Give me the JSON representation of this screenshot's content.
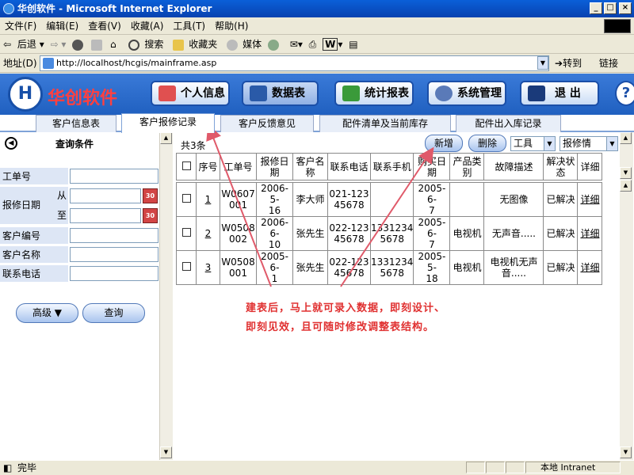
{
  "window": {
    "title": "华创软件 - Microsoft Internet Explorer",
    "controls": [
      "_",
      "□",
      "×"
    ]
  },
  "menu": [
    "文件(F)",
    "编辑(E)",
    "查看(V)",
    "收藏(A)",
    "工具(T)",
    "帮助(H)"
  ],
  "toolbar": {
    "back": "后退",
    "search": "搜索",
    "favorites": "收藏夹",
    "media": "媒体"
  },
  "address": {
    "label": "地址(D)",
    "url": "http://localhost/hcgis/mainframe.asp",
    "go": "转到",
    "links": "链接"
  },
  "app": {
    "logo": "H",
    "brand": "华创软件",
    "nav": [
      "个人信息",
      "数据表",
      "统计报表",
      "系统管理",
      "退  出"
    ],
    "help": "?"
  },
  "tabs": [
    "客户信息表",
    "客户报修记录",
    "客户反馈意见",
    "配件清单及当前库存",
    "配件出入库记录"
  ],
  "query": {
    "title": "查询条件",
    "fields": {
      "ticket": "工单号",
      "date": "报修日期",
      "from": "从",
      "to": "至",
      "cust_no": "客户编号",
      "cust_name": "客户名称",
      "phone": "联系电话"
    },
    "calendar_label": "30",
    "advanced": "高级 ▼",
    "search": "查询"
  },
  "grid": {
    "count": "共3条",
    "add": "新增",
    "delete": "删除",
    "tool_select": "工具",
    "field_select": "报修情",
    "headers": [
      "序号",
      "工单号",
      "报修日期",
      "客户名称",
      "联系电话",
      "联系手机",
      "购买日期",
      "产品类别",
      "故障描述",
      "解决状态",
      "详细"
    ],
    "rows": [
      {
        "no": "1",
        "ticket": [
          "W0607",
          "001"
        ],
        "date": [
          "2006-5-",
          "16"
        ],
        "cust": "李大师",
        "phone": [
          "021-123",
          "45678"
        ],
        "mobile": [
          "",
          ""
        ],
        "buy": [
          "2005-6-",
          "7"
        ],
        "product": "",
        "fault": "无图像",
        "status": "已解决",
        "detail": "详细"
      },
      {
        "no": "2",
        "ticket": [
          "W0508",
          "002"
        ],
        "date": [
          "2006-6-",
          "10"
        ],
        "cust": "张先生",
        "phone": [
          "022-123",
          "45678"
        ],
        "mobile": [
          "1331234",
          "5678"
        ],
        "buy": [
          "2005-6-",
          "7"
        ],
        "product": "电视机",
        "fault": "无声音.....",
        "status": "已解决",
        "detail": "详细"
      },
      {
        "no": "3",
        "ticket": [
          "W0508",
          "001"
        ],
        "date": [
          "2005-6-",
          "1"
        ],
        "cust": "张先生",
        "phone": [
          "022-123",
          "45678"
        ],
        "mobile": [
          "1331234",
          "5678"
        ],
        "buy": [
          "2005-5-",
          "18"
        ],
        "product": "电视机",
        "fault": [
          "电视机无声",
          "音....."
        ],
        "status": "已解决",
        "detail": "详细"
      }
    ]
  },
  "annotation": [
    "建表后，马上就可录入数据，即刻设计、",
    "即刻见效，且可随时修改调整表结构。"
  ],
  "status": {
    "left": "完毕",
    "zone": "本地 Intranet"
  },
  "colors": {
    "titlebar": "#0a5fd8",
    "header": "#2e6ed0",
    "brand": "#ff4040",
    "annotation": "#e03030"
  }
}
